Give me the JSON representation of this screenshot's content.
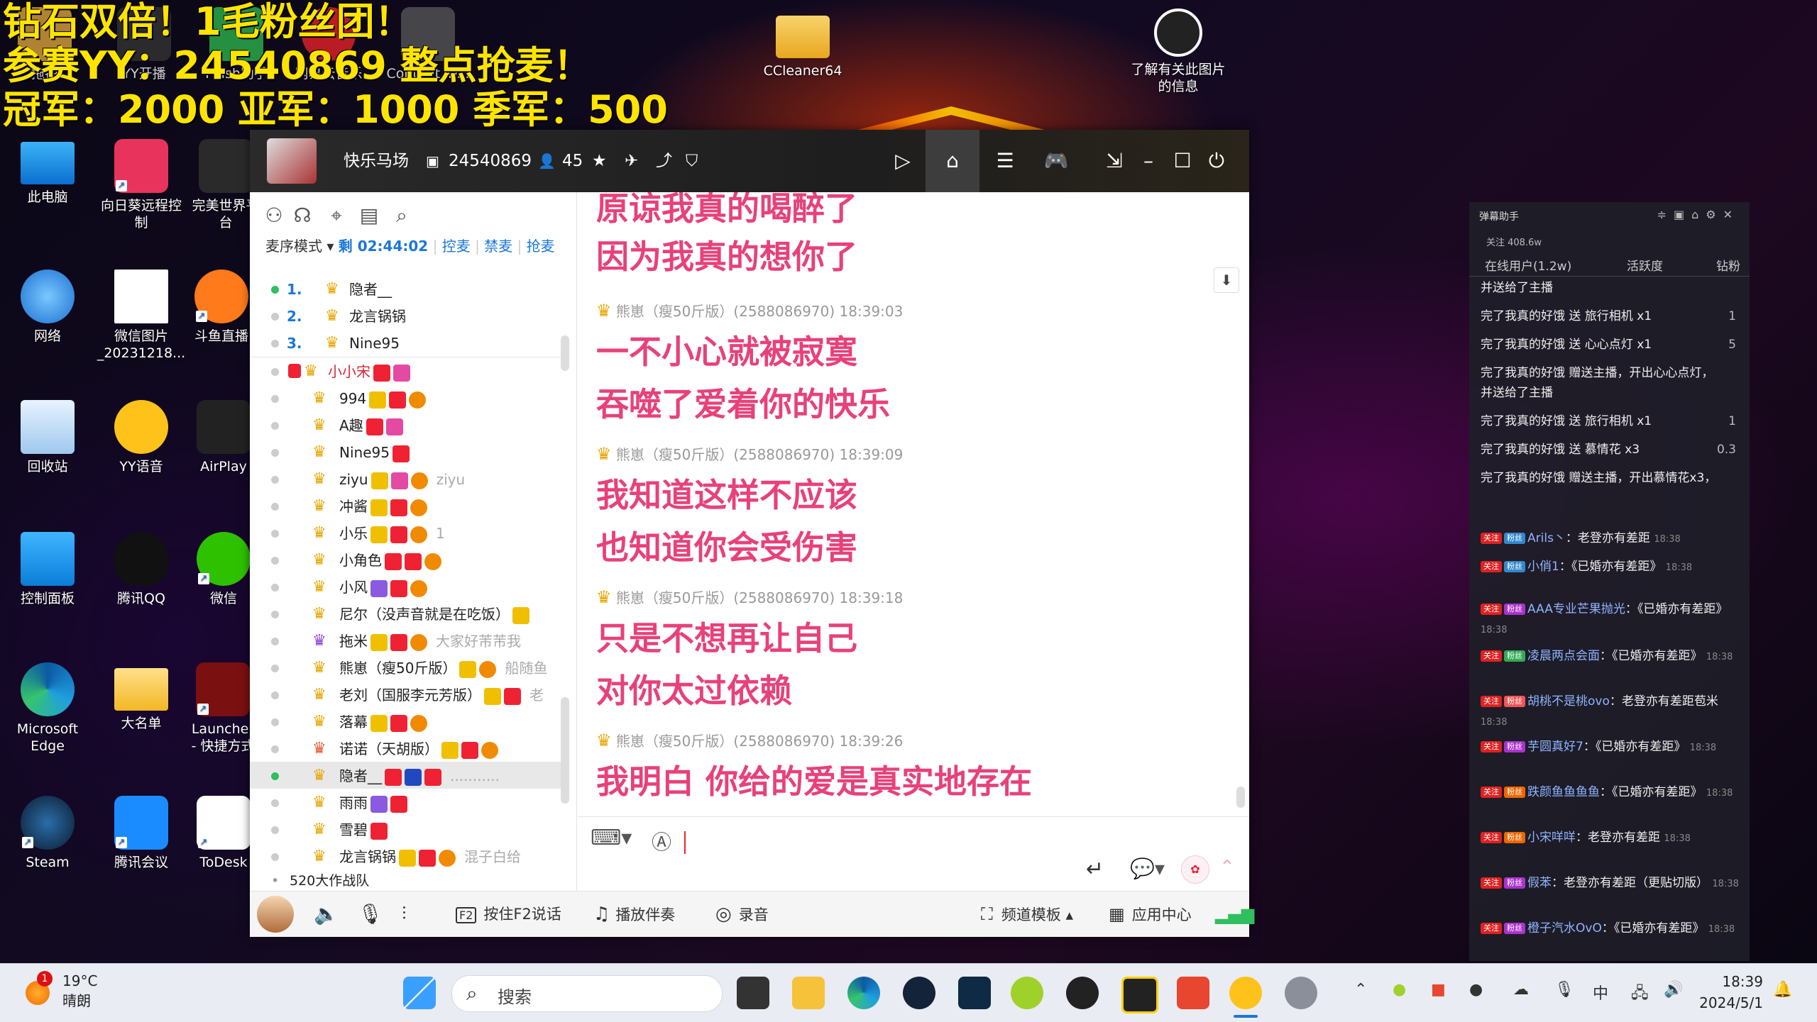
{
  "overlay": {
    "line1": "钻石双倍！1毛粉丝团！",
    "line2": "参赛YY：24540869 整点抢麦！",
    "line3": "冠军：2000 亚军：1000 季军：500"
  },
  "desktop_icons": {
    "this_pc": "此电脑",
    "sunflower": "向日葵远程控制",
    "perfect_world": "完美世界平台",
    "network": "网络",
    "wechat_image": "微信图片_20231218...",
    "douyu": "斗鱼直播",
    "recycle": "回收站",
    "yy_voice": "YY语音",
    "airplay": "AirPlay",
    "control_panel": "控制面板",
    "qq": "腾讯QQ",
    "wechat": "微信",
    "edge": "Microsoft Edge",
    "daming": "大名单",
    "launcher": "Launcher - 快捷方式",
    "steam": "Steam",
    "meeting": "腾讯会议",
    "todesk": "ToDesk",
    "ccleaner": "CCleaner64",
    "learn_image": "了解有关此图片的信息",
    "top_row": [
      "拖拽",
      "YY开播",
      "Flash助手",
      "网易云音乐",
      "Content_w..."
    ]
  },
  "yy": {
    "channel_name": "快乐马场",
    "channel_id": "24540869",
    "online_count": "45",
    "mic_mode": "麦序模式",
    "remaining": "剩 02:44:02",
    "links": [
      "控麦",
      "禁麦",
      "抢麦"
    ],
    "queue": [
      {
        "num": "1.",
        "name": "隐者__"
      },
      {
        "num": "2.",
        "name": "龙言锅锅"
      },
      {
        "num": "3.",
        "name": "Nine95"
      }
    ],
    "members": [
      {
        "name": "小小宋",
        "extra": ""
      },
      {
        "name": "994",
        "extra": ""
      },
      {
        "name": "A趣",
        "extra": ""
      },
      {
        "name": "Nine95",
        "extra": ""
      },
      {
        "name": "ziyu",
        "extra": "ziyu"
      },
      {
        "name": "冲酱",
        "extra": ""
      },
      {
        "name": "小乐",
        "extra": "1"
      },
      {
        "name": "小角色",
        "extra": ""
      },
      {
        "name": "小风",
        "extra": ""
      },
      {
        "name": "尼尔（没声音就是在吃饭）",
        "extra": ""
      },
      {
        "name": "拖米",
        "extra": "大家好芾芾我"
      },
      {
        "name": "熊崽（瘦50斤版）",
        "extra": "船随鱼"
      },
      {
        "name": "老刘（国服李元芳版）",
        "extra": "老"
      },
      {
        "name": "落幕",
        "extra": ""
      },
      {
        "name": "诺诺（天胡版）",
        "extra": ""
      },
      {
        "name": "隐者__",
        "extra": "..........."
      },
      {
        "name": "雨雨",
        "extra": ""
      },
      {
        "name": "雪碧",
        "extra": ""
      },
      {
        "name": "龙言锅锅",
        "extra": "混子白给"
      }
    ],
    "subchannel": "520大作战队",
    "chat": {
      "lyric0": "原谅我真的喝醉了",
      "lyric1": "因为我真的想你了",
      "msgs": [
        {
          "meta": "熊崽（瘦50斤版）(2588086970) 18:39:03",
          "l1": "一不小心就被寂寞",
          "l2": "吞噬了爱着你的快乐"
        },
        {
          "meta": "熊崽（瘦50斤版）(2588086970) 18:39:09",
          "l1": "我知道这样不应该",
          "l2": "也知道你会受伤害"
        },
        {
          "meta": "熊崽（瘦50斤版）(2588086970) 18:39:18",
          "l1": "只是不想再让自己",
          "l2": "对你太过依赖"
        },
        {
          "meta": "熊崽（瘦50斤版）(2588086970) 18:39:26",
          "l1": "我明白 你给的爱是真实地存在",
          "l2": ""
        }
      ]
    },
    "bottom": {
      "f2": "按住F2说话",
      "accompany": "播放伴奏",
      "record": "录音",
      "template": "频道模板",
      "appcenter": "应用中心"
    }
  },
  "danmu": {
    "title": "弹幕助手",
    "fans": "关注 408.6w",
    "tabs": [
      "在线用户(1.2w)",
      "活跃度",
      "钻粉"
    ],
    "gifts": [
      {
        "text": "并送给了主播",
        "right": ""
      },
      {
        "text": "完了我真的好饿 送 旅行相机 x1",
        "right": "1"
      },
      {
        "text": "完了我真的好饿 送 心心点灯 x1",
        "right": "5"
      },
      {
        "text": "完了我真的好饿 赠送主播，开出心心点灯，",
        "right": ""
      },
      {
        "text": "并送给了主播",
        "right": ""
      },
      {
        "text": "完了我真的好饿 送 旅行相机 x1",
        "right": "1"
      },
      {
        "text": "完了我真的好饿 送 慕情花 x3",
        "right": "0.3"
      },
      {
        "text": "完了我真的好饿 赠送主播，开出慕情花x3，",
        "right": ""
      }
    ],
    "comments": [
      {
        "name": "Arils丶",
        "text": "老登亦有差距",
        "time": "18:38"
      },
      {
        "name": "小俏1",
        "text": "《已婚亦有差距》",
        "time": "18:38"
      },
      {
        "name": "AAA专业芒果抛光",
        "text": "《已婚亦有差距》",
        "time": "18:38"
      },
      {
        "name": "凌晨两点会面",
        "text": "《已婚亦有差距》",
        "time": "18:38"
      },
      {
        "name": "胡桃不是桃ovo",
        "text": "老登亦有差距苞米",
        "time": "18:38"
      },
      {
        "name": "芋圆真好7",
        "text": "《已婚亦有差距》",
        "time": "18:38"
      },
      {
        "name": "跌颜鱼鱼鱼鱼",
        "text": "《已婚亦有差距》",
        "time": "18:38"
      },
      {
        "name": "小宋咩咩",
        "text": "老登亦有差距",
        "time": "18:38"
      },
      {
        "name": "假苯",
        "text": "老登亦有差距（更贴切版）",
        "time": "18:38"
      },
      {
        "name": "橙子汽水OvO",
        "text": "《已婚亦有差距》",
        "time": "18:38"
      }
    ]
  },
  "taskbar": {
    "temp": "19°C",
    "weather": "晴朗",
    "search": "搜索",
    "ime": "中",
    "time": "18:39",
    "date": "2024/5/1",
    "badge": "1"
  },
  "colors": {
    "lyric": "#e8417a",
    "accent": "#1c77d6",
    "overlay": "#ffe400"
  }
}
